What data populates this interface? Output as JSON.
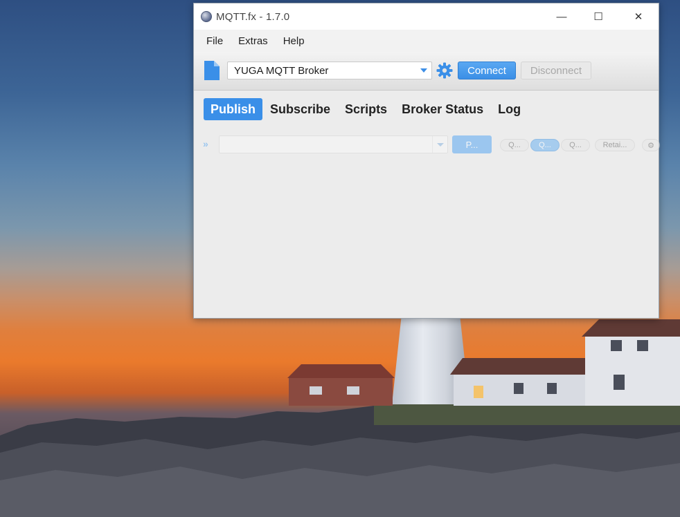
{
  "window": {
    "title": "MQTT.fx - 1.7.0",
    "controls": {
      "minimize": "—",
      "maximize": "☐",
      "close": "✕"
    }
  },
  "menu": {
    "items": [
      "File",
      "Extras",
      "Help"
    ]
  },
  "toolbar": {
    "broker": "YUGA MQTT Broker",
    "connect_label": "Connect",
    "disconnect_label": "Disconnect"
  },
  "tabs": {
    "items": [
      {
        "label": "Publish",
        "active": true
      },
      {
        "label": "Subscribe",
        "active": false
      },
      {
        "label": "Scripts",
        "active": false
      },
      {
        "label": "Broker Status",
        "active": false
      },
      {
        "label": "Log",
        "active": false
      }
    ]
  },
  "publish": {
    "expand_icon": "»",
    "topic_value": "",
    "publish_label": "P...",
    "qos0_label": "Q...",
    "qos1_label": "Q...",
    "qos2_label": "Q...",
    "retain_label": "Retai...",
    "options_icon": "gear-icon",
    "qos_selected": 1,
    "enabled": false
  },
  "colors": {
    "accent": "#3a8fe8",
    "window_bg": "#ececec"
  }
}
